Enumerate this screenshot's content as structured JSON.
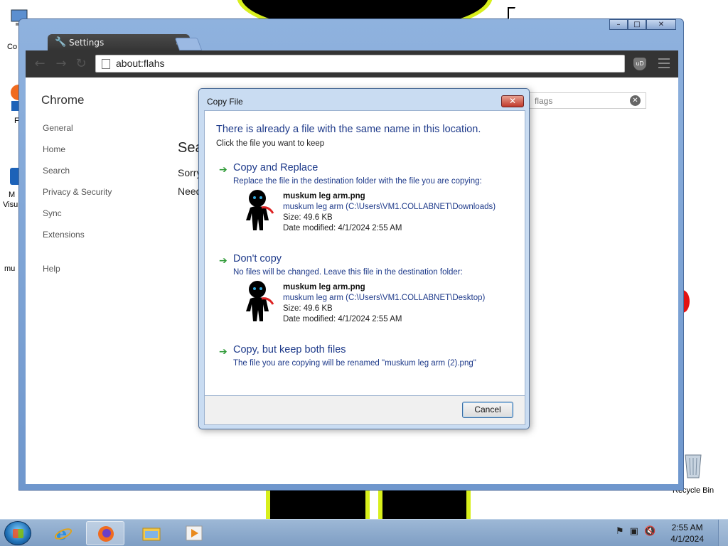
{
  "desktop": {
    "icons": [
      {
        "label": "Co",
        "icon": "computer-icon"
      },
      {
        "label": "F",
        "icon": "firefox-icon"
      },
      {
        "label": "M",
        "icon": "app-icon"
      },
      {
        "label": "Visu",
        "icon": "app-icon"
      },
      {
        "label": "mu",
        "icon": "file-icon"
      },
      {
        "label": "Recycle Bin",
        "icon": "recycle-bin-icon"
      }
    ]
  },
  "browser": {
    "tab_title": "Settings",
    "tab_close": "×",
    "address": "about:flahs",
    "ext_label": "uD",
    "window_controls": {
      "minimize": "–",
      "maximize": "□",
      "close": "✕"
    }
  },
  "settings": {
    "title": "Chrome",
    "nav": [
      "General",
      "Home",
      "Search",
      "Privacy & Security",
      "Sync",
      "Extensions",
      "Help"
    ],
    "search_value": "flags",
    "main_heading": "Sea",
    "main_line1": "Sorry",
    "main_line2": "Need"
  },
  "dialog": {
    "title": "Copy File",
    "close_glyph": "✕",
    "heading": "There is already a file with the same name in this location.",
    "subheading": "Click the file you want to keep",
    "options": [
      {
        "title": "Copy and Replace",
        "description": "Replace the file in the destination folder with the file you are copying:",
        "file": {
          "name": "muskum leg arm.png",
          "path": "muskum leg arm (C:\\Users\\VM1.COLLABNET\\Downloads)",
          "size": "Size: 49.6 KB",
          "modified": "Date modified: 4/1/2024 2:55 AM"
        }
      },
      {
        "title": "Don't copy",
        "description": "No files will be changed. Leave this file in the destination folder:",
        "file": {
          "name": "muskum leg arm.png",
          "path": "muskum leg arm (C:\\Users\\VM1.COLLABNET\\Desktop)",
          "size": "Size: 49.6 KB",
          "modified": "Date modified: 4/1/2024 2:55 AM"
        }
      },
      {
        "title": "Copy, but keep both files",
        "description": "The file you are copying will be renamed \"muskum leg arm (2).png\""
      }
    ],
    "cancel_label": "Cancel"
  },
  "taskbar": {
    "apps": [
      "internet-explorer-icon",
      "firefox-icon",
      "file-explorer-icon",
      "media-player-icon"
    ],
    "tray_icons": [
      "flag-icon",
      "network-icon",
      "volume-muted-icon"
    ],
    "time": "2:55 AM",
    "date": "4/1/2024"
  },
  "colors": {
    "dialog_link": "#1e3a8a",
    "arrow_green": "#2e9a36",
    "wallpaper_accent": "#d8ef1c"
  }
}
